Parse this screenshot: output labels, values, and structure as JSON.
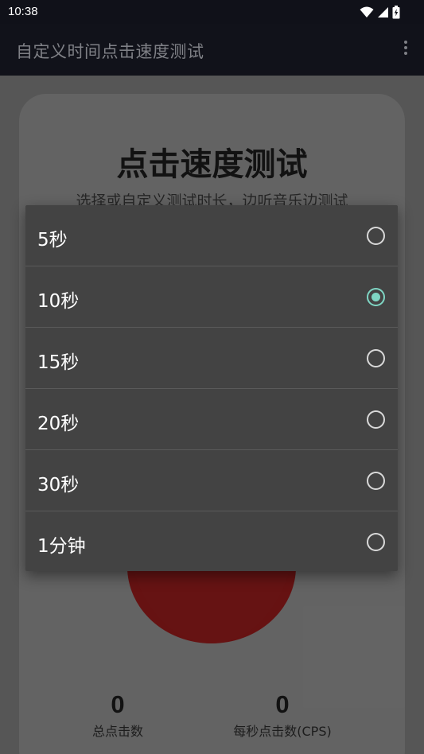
{
  "status_bar": {
    "time": "10:38"
  },
  "app_bar": {
    "title": "自定义时间点击速度测试"
  },
  "card": {
    "title": "点击速度测试",
    "subtitle": "选择或自定义测试时长，边听音乐边测试"
  },
  "stats": {
    "total_value": "0",
    "total_label": "总点击数",
    "cps_value": "0",
    "cps_label": "每秒点击数(CPS)"
  },
  "dialog": {
    "options": [
      {
        "label": "5秒",
        "selected": false
      },
      {
        "label": "10秒",
        "selected": true
      },
      {
        "label": "15秒",
        "selected": false
      },
      {
        "label": "20秒",
        "selected": false
      },
      {
        "label": "30秒",
        "selected": false
      },
      {
        "label": "1分钟",
        "selected": false
      }
    ]
  },
  "colors": {
    "radio_selected": "#7fd6c4",
    "tap_button": "#6f1414"
  },
  "icons": [
    "wifi-icon",
    "signal-icon",
    "battery-icon",
    "more-vert-icon"
  ]
}
